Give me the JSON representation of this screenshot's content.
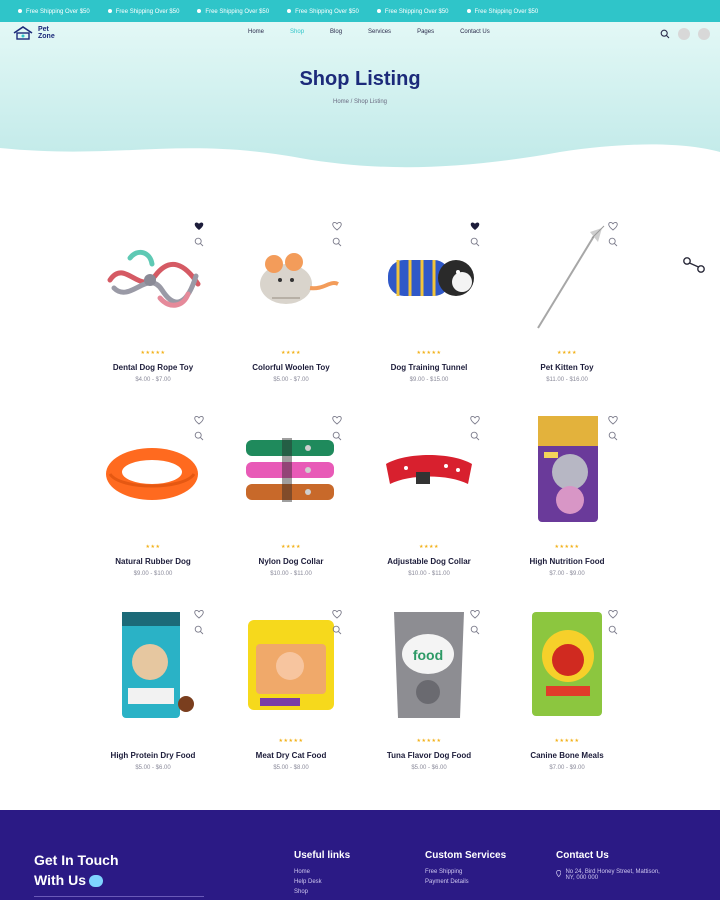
{
  "topbar": {
    "items": [
      "Free Shipping Over $50",
      "Free Shipping Over $50",
      "Free Shipping Over $50",
      "Free Shipping Over $50",
      "Free Shipping Over $50",
      "Free Shipping Over $50"
    ]
  },
  "brand": {
    "name_line1": "Pet",
    "name_line2": "Zone"
  },
  "nav": [
    "Home",
    "Shop",
    "Blog",
    "Services",
    "Pages",
    "Contact Us"
  ],
  "page": {
    "title": "Shop Listing",
    "breadcrumb": "Home / Shop Listing"
  },
  "products": [
    {
      "title": "Dental Dog Rope Toy",
      "price": "$4.00 - $7.00",
      "stars": "★★★★★",
      "wish": true,
      "image": "rope-toy"
    },
    {
      "title": "Colorful Woolen Toy",
      "price": "$5.00 - $7.00",
      "stars": "★★★★",
      "wish": false,
      "image": "woolen-mouse"
    },
    {
      "title": "Dog Training Tunnel",
      "price": "$9.00 - $15.00",
      "stars": "★★★★★",
      "wish": true,
      "image": "tunnel"
    },
    {
      "title": "Pet Kitten Toy",
      "price": "$11.00 - $16.00",
      "stars": "★★★★",
      "wish": false,
      "image": "kitten-wand"
    },
    {
      "title": "Natural Rubber Dog",
      "price": "$9.00 - $10.00",
      "stars": "★★★",
      "wish": false,
      "image": "rubber-ring"
    },
    {
      "title": "Nylon Dog Collar",
      "price": "$10.00 - $11.00",
      "stars": "★★★★",
      "wish": false,
      "image": "nylon-collars"
    },
    {
      "title": "Adjustable Dog Collar",
      "price": "$10.00 - $11.00",
      "stars": "★★★★",
      "wish": false,
      "image": "red-collar"
    },
    {
      "title": "High Nutrition Food",
      "price": "$7.00 - $9.00",
      "stars": "★★★★★",
      "wish": false,
      "image": "kitten-food"
    },
    {
      "title": "High Protein Dry Food",
      "price": "$5.00 - $6.00",
      "stars": "",
      "wish": false,
      "image": "dry-food-bag"
    },
    {
      "title": "Meat Dry Cat Food",
      "price": "$5.00 - $8.00",
      "stars": "★★★★★",
      "wish": false,
      "image": "cat-food-yellow"
    },
    {
      "title": "Tuna Flavor Dog Food",
      "price": "$5.00 - $6.00",
      "stars": "★★★★★",
      "wish": false,
      "image": "grey-food-pouch"
    },
    {
      "title": "Canine Bone Meals",
      "price": "$7.00 - $9.00",
      "stars": "★★★★★",
      "wish": false,
      "image": "green-food-bag"
    }
  ],
  "footer": {
    "touch_line1": "Get In Touch",
    "touch_line2": "With Us",
    "useful_heading": "Useful links",
    "useful_links": [
      "Home",
      "Help Desk",
      "Shop"
    ],
    "services_heading": "Custom Services",
    "services_links": [
      "Free Shipping",
      "Payment Details"
    ],
    "contact_heading": "Contact Us",
    "contact_address": "No 24, Bird Honey Street, Mattison, NY, 000 000"
  },
  "colors": {
    "accent": "#2fc5c9",
    "navy": "#1c2a7a",
    "footer_bg": "#2b1a85",
    "star": "#f2b21c"
  },
  "icons": {
    "wishlist": "heart-icon",
    "quickview": "search-icon",
    "cart": "cart-icon",
    "search": "search-icon"
  }
}
